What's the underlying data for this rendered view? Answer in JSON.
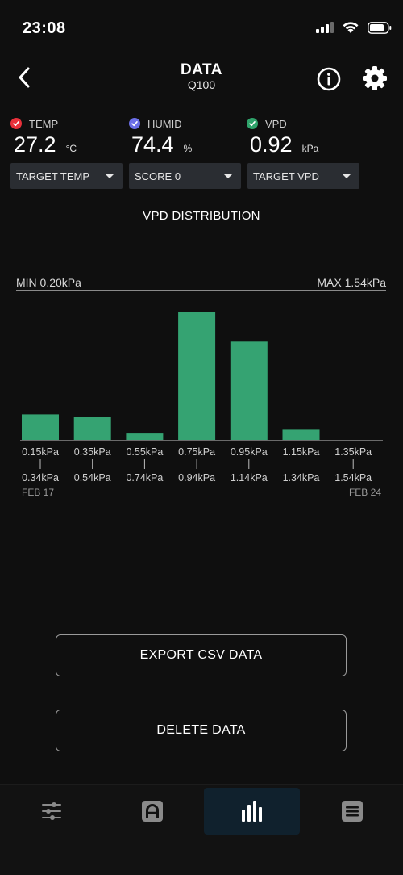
{
  "status": {
    "time": "23:08"
  },
  "header": {
    "title": "DATA",
    "subtitle": "Q100"
  },
  "readings": [
    {
      "label": "TEMP",
      "value": "27.2",
      "unit": "°C",
      "color": "#e8303a"
    },
    {
      "label": "HUMID",
      "value": "74.4",
      "unit": "%",
      "color": "#6b6ee8"
    },
    {
      "label": "VPD",
      "value": "0.92",
      "unit": "kPa",
      "color": "#2fa36b"
    }
  ],
  "dropdowns": [
    {
      "label": "TARGET TEMP"
    },
    {
      "label": "SCORE 0"
    },
    {
      "label": "TARGET VPD"
    }
  ],
  "chart_data": {
    "type": "bar",
    "title": "VPD DISTRIBUTION",
    "min_label": "MIN 0.20kPa",
    "max_label": "MAX 1.54kPa",
    "categories": [
      {
        "low": "0.15kPa",
        "high": "0.34kPa"
      },
      {
        "low": "0.35kPa",
        "high": "0.54kPa"
      },
      {
        "low": "0.55kPa",
        "high": "0.74kPa"
      },
      {
        "low": "0.75kPa",
        "high": "0.94kPa"
      },
      {
        "low": "0.95kPa",
        "high": "1.14kPa"
      },
      {
        "low": "1.15kPa",
        "high": "1.34kPa"
      },
      {
        "low": "1.35kPa",
        "high": "1.54kPa"
      }
    ],
    "values": [
      20,
      18,
      5,
      100,
      77,
      8,
      0
    ],
    "ylim": [
      0,
      100
    ],
    "date_start": "FEB 17",
    "date_end": "FEB 24",
    "bar_color": "#35a372"
  },
  "actions": {
    "export_label": "EXPORT CSV DATA",
    "delete_label": "DELETE DATA"
  },
  "nav": [
    {
      "icon": "sliders-icon"
    },
    {
      "icon": "device-icon"
    },
    {
      "icon": "bar-chart-icon",
      "active": true
    },
    {
      "icon": "list-icon"
    }
  ]
}
